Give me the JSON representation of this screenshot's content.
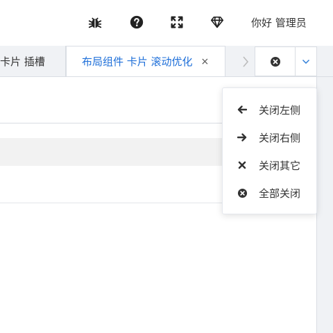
{
  "header": {
    "greeting": "你好 管理员",
    "icons": [
      "bug-icon",
      "help-icon",
      "fullscreen-icon",
      "diamond-icon"
    ]
  },
  "tabs": {
    "items": [
      {
        "label": "卡片 插槽",
        "active": false
      },
      {
        "label": "布局组件 卡片 滚动优化",
        "active": true,
        "close": "×"
      }
    ]
  },
  "menu": {
    "items": [
      {
        "label": "关闭左侧",
        "icon": "arrow-left-icon"
      },
      {
        "label": "关闭右侧",
        "icon": "arrow-right-icon"
      },
      {
        "label": "关闭其它",
        "icon": "close-x-icon"
      },
      {
        "label": "全部关闭",
        "icon": "close-circle-icon"
      }
    ]
  },
  "colors": {
    "accent": "#1e6fd9",
    "background": "#f0f2f5"
  }
}
